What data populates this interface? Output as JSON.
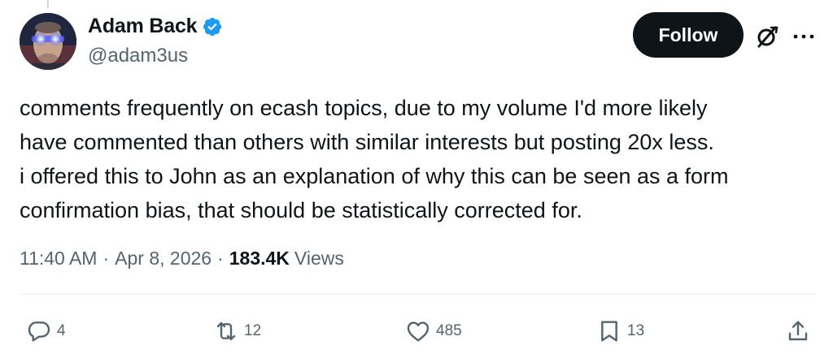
{
  "author": {
    "name": "Adam Back",
    "handle": "@adam3us",
    "verified": true,
    "avatar_icon": "avatar-glowing-eyes"
  },
  "header": {
    "follow_label": "Follow"
  },
  "tweet": {
    "text": "comments frequently on ecash topics, due to my volume I'd more likely\nhave commented than others with similar interests but posting 20x less.\ni offered this to John as an explanation of why this can be seen as a form\nconfirmation bias, that should be statistically corrected for.",
    "time": "11:40 AM",
    "separator": "·",
    "date": "Apr 8, 2026",
    "views_count": "183.4K",
    "views_label": "Views"
  },
  "actions": {
    "replies": "4",
    "reposts": "12",
    "likes": "485",
    "bookmarks": "13"
  },
  "colors": {
    "text_primary": "#0f1419",
    "text_secondary": "#536471",
    "verified_blue": "#1d9bf0",
    "follow_bg": "#0f1419",
    "divider": "#eff3f4"
  }
}
